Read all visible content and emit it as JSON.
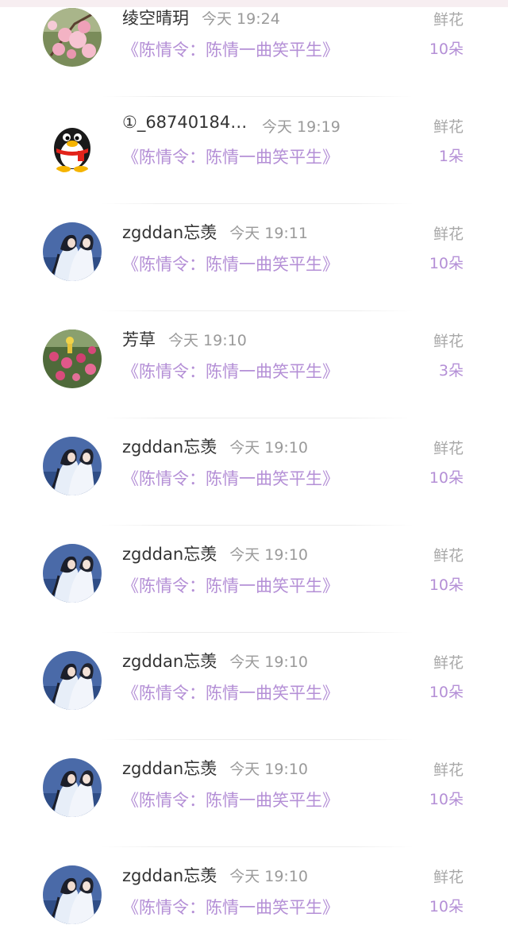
{
  "book_title": "《陈情令：陈情一曲笑平生》",
  "gift_label": "鲜花",
  "colors": {
    "accent": "#b48fd6",
    "name": "#333333",
    "muted": "#9a9a9a"
  },
  "entries": [
    {
      "nickname": "绫空晴玥",
      "time": "今天 19:24",
      "count": "10朵",
      "avatar": "pink-blossom-avatar"
    },
    {
      "nickname": "①_687401843...",
      "time": "今天 19:19",
      "count": "1朵",
      "avatar": "qq-penguin-avatar"
    },
    {
      "nickname": "zgddan忘羡",
      "time": "今天 19:11",
      "count": "10朵",
      "avatar": "anime-duo-avatar"
    },
    {
      "nickname": "芳草",
      "time": "今天 19:10",
      "count": "3朵",
      "avatar": "rose-bush-avatar"
    },
    {
      "nickname": "zgddan忘羡",
      "time": "今天 19:10",
      "count": "10朵",
      "avatar": "anime-duo-avatar"
    },
    {
      "nickname": "zgddan忘羡",
      "time": "今天 19:10",
      "count": "10朵",
      "avatar": "anime-duo-avatar"
    },
    {
      "nickname": "zgddan忘羡",
      "time": "今天 19:10",
      "count": "10朵",
      "avatar": "anime-duo-avatar"
    },
    {
      "nickname": "zgddan忘羡",
      "time": "今天 19:10",
      "count": "10朵",
      "avatar": "anime-duo-avatar"
    },
    {
      "nickname": "zgddan忘羡",
      "time": "今天 19:10",
      "count": "10朵",
      "avatar": "anime-duo-avatar"
    }
  ]
}
